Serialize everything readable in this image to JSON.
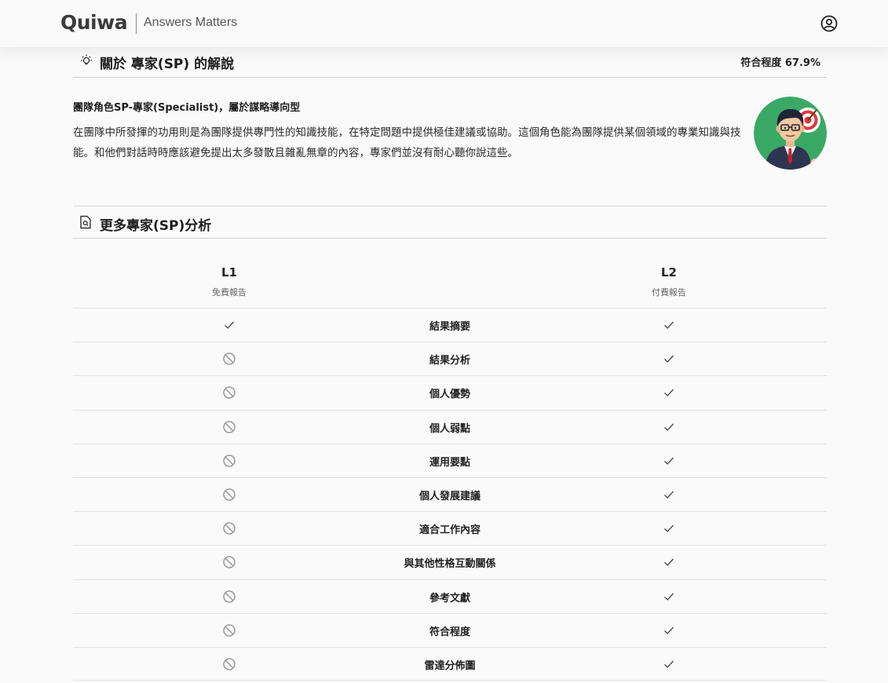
{
  "header": {
    "logo": "Quiwa",
    "tagline": "Answers Matters",
    "account_icon": "user-circle-icon"
  },
  "about": {
    "icon": "lightbulb-icon",
    "title": "關於 專家(SP) 的解說",
    "match_label": "符合程度 67.9%",
    "role_heading": "團隊角色SP-專家(Specialist)，屬於謀略導向型",
    "role_description": "在團隊中所發揮的功用則是為團隊提供專門性的知識技能，在特定問題中提供極佳建議或協助。這個角色能為團隊提供某個領域的專業知識與技能。和他們對話時時應該避免提出太多發散且雜亂無章的內容，專家們並沒有耐心聽你說這些。",
    "avatar_colors": {
      "bg": "#3aa965",
      "suit": "#2d3552",
      "skin": "#f2c9a0",
      "target_red": "#e0393b"
    }
  },
  "analysis": {
    "icon": "document-icon",
    "title": "更多專家(SP)分析",
    "columns": {
      "l1": {
        "level": "L1",
        "label": "免費報告"
      },
      "l2": {
        "level": "L2",
        "label": "付費報告"
      }
    },
    "rows": [
      {
        "feature": "結果摘要",
        "l1": "check",
        "l2": "check"
      },
      {
        "feature": "結果分析",
        "l1": "blocked",
        "l2": "check"
      },
      {
        "feature": "個人優勢",
        "l1": "blocked",
        "l2": "check"
      },
      {
        "feature": "個人弱點",
        "l1": "blocked",
        "l2": "check"
      },
      {
        "feature": "運用要點",
        "l1": "blocked",
        "l2": "check"
      },
      {
        "feature": "個人發展建議",
        "l1": "blocked",
        "l2": "check"
      },
      {
        "feature": "適合工作內容",
        "l1": "blocked",
        "l2": "check"
      },
      {
        "feature": "與其他性格互動關係",
        "l1": "blocked",
        "l2": "check"
      },
      {
        "feature": "參考文獻",
        "l1": "blocked",
        "l2": "check"
      },
      {
        "feature": "符合程度",
        "l1": "blocked",
        "l2": "check"
      },
      {
        "feature": "雷達分佈圖",
        "l1": "blocked",
        "l2": "check"
      }
    ]
  }
}
